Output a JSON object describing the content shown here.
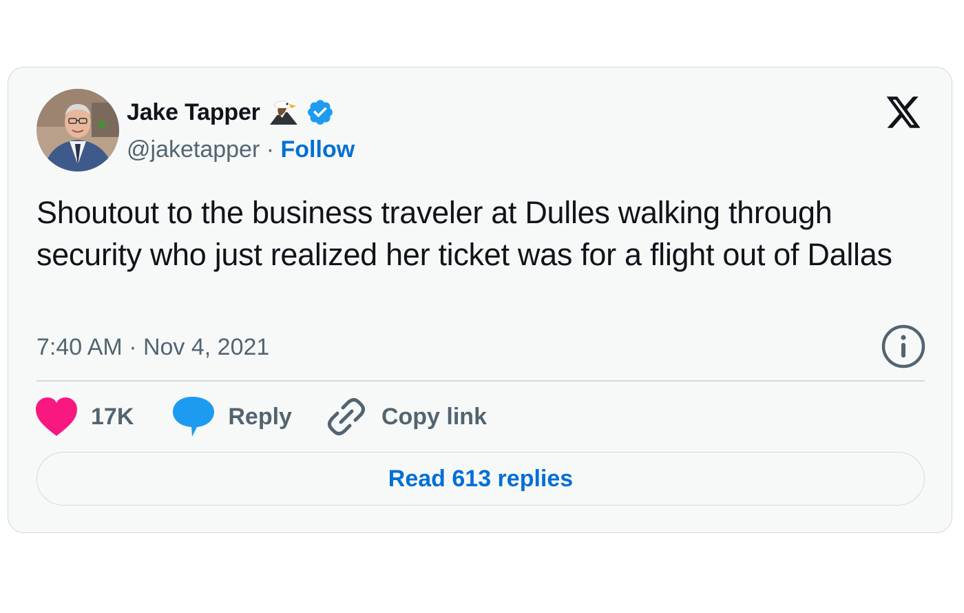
{
  "tweet": {
    "author_name": "Jake Tapper",
    "author_emoji": "eagle-icon",
    "verified": true,
    "handle": "@jaketapper",
    "separator": " · ",
    "follow_label": "Follow",
    "text": "Shoutout to the business traveler at Dulles walking through security who just realized her ticket was for a flight out of Dallas",
    "timestamp": "7:40 AM · Nov 4, 2021"
  },
  "actions": {
    "like_count": "17K",
    "reply_label": "Reply",
    "copy_label": "Copy link"
  },
  "footer": {
    "read_replies_label": "Read 613 replies"
  },
  "colors": {
    "card_background": "#f7f9f9",
    "border": "#cfd9de",
    "text_primary": "#0f1419",
    "text_secondary": "#536471",
    "link_blue": "#006fd6",
    "verified_blue": "#1d9bf0",
    "like_pink": "#f91880",
    "reply_blue": "#1d9bf0"
  }
}
